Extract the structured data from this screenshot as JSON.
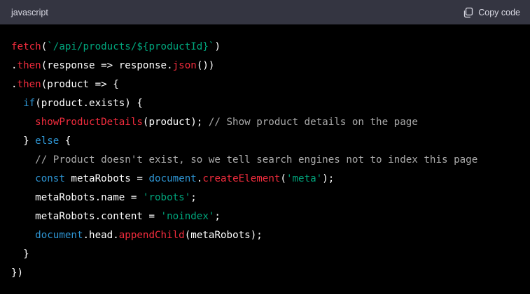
{
  "header": {
    "language": "javascript",
    "copy_label": "Copy code"
  },
  "code": {
    "lines": [
      [
        {
          "t": "fetch",
          "c": "call"
        },
        {
          "t": "(",
          "c": "plain"
        },
        {
          "t": "`/api/products/${productId}`",
          "c": "string"
        },
        {
          "t": ")",
          "c": "plain"
        }
      ],
      [
        {
          "t": ".",
          "c": "plain"
        },
        {
          "t": "then",
          "c": "call"
        },
        {
          "t": "(response => response.",
          "c": "plain"
        },
        {
          "t": "json",
          "c": "call"
        },
        {
          "t": "())",
          "c": "plain"
        }
      ],
      [
        {
          "t": ".",
          "c": "plain"
        },
        {
          "t": "then",
          "c": "call"
        },
        {
          "t": "(product => {",
          "c": "plain"
        }
      ],
      [
        {
          "t": "  ",
          "c": "plain"
        },
        {
          "t": "if",
          "c": "keyword"
        },
        {
          "t": "(product.exists) {",
          "c": "plain"
        }
      ],
      [
        {
          "t": "    ",
          "c": "plain"
        },
        {
          "t": "showProductDetails",
          "c": "call"
        },
        {
          "t": "(product); ",
          "c": "plain"
        },
        {
          "t": "// Show product details on the page",
          "c": "comment"
        }
      ],
      [
        {
          "t": "  } ",
          "c": "plain"
        },
        {
          "t": "else",
          "c": "keyword"
        },
        {
          "t": " {",
          "c": "plain"
        }
      ],
      [
        {
          "t": "    ",
          "c": "plain"
        },
        {
          "t": "// Product doesn't exist, so we tell search engines not to index this page",
          "c": "comment"
        }
      ],
      [
        {
          "t": "    ",
          "c": "plain"
        },
        {
          "t": "const",
          "c": "keyword"
        },
        {
          "t": " metaRobots = ",
          "c": "plain"
        },
        {
          "t": "document",
          "c": "keyword"
        },
        {
          "t": ".",
          "c": "plain"
        },
        {
          "t": "createElement",
          "c": "call"
        },
        {
          "t": "(",
          "c": "plain"
        },
        {
          "t": "'meta'",
          "c": "string"
        },
        {
          "t": ");",
          "c": "plain"
        }
      ],
      [
        {
          "t": "    metaRobots.name = ",
          "c": "plain"
        },
        {
          "t": "'robots'",
          "c": "string"
        },
        {
          "t": ";",
          "c": "plain"
        }
      ],
      [
        {
          "t": "    metaRobots.content = ",
          "c": "plain"
        },
        {
          "t": "'noindex'",
          "c": "string"
        },
        {
          "t": ";",
          "c": "plain"
        }
      ],
      [
        {
          "t": "    ",
          "c": "plain"
        },
        {
          "t": "document",
          "c": "keyword"
        },
        {
          "t": ".head.",
          "c": "plain"
        },
        {
          "t": "appendChild",
          "c": "call"
        },
        {
          "t": "(metaRobots);",
          "c": "plain"
        }
      ],
      [
        {
          "t": "  }",
          "c": "plain"
        }
      ],
      [
        {
          "t": "})",
          "c": "plain"
        }
      ]
    ]
  },
  "colors": {
    "header_background": "#343541",
    "code_background": "#000000",
    "call": "#f22c3d",
    "string": "#00a67d",
    "keyword": "#2e95d3",
    "comment": "#aaaaaa",
    "plain": "#ffffff"
  },
  "icons": {
    "copy": "clipboard-icon"
  }
}
